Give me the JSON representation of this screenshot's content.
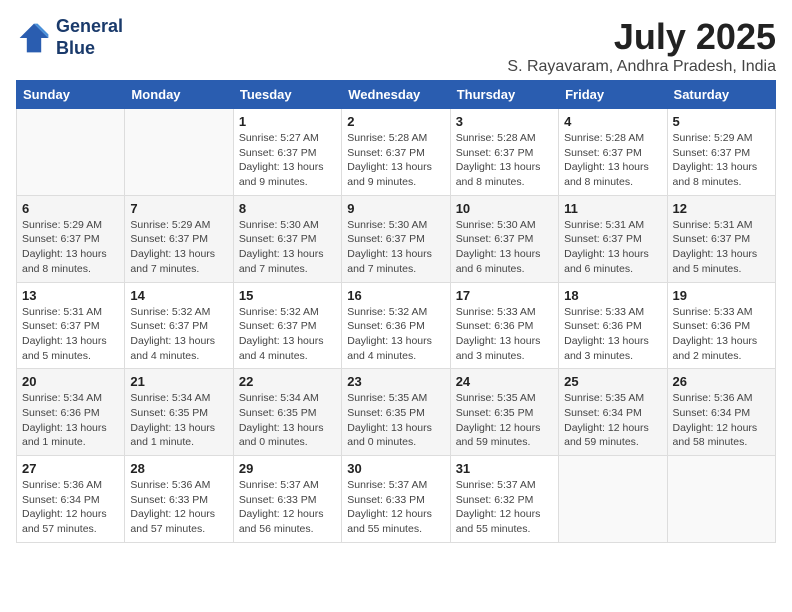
{
  "logo": {
    "line1": "General",
    "line2": "Blue"
  },
  "title": "July 2025",
  "subtitle": "S. Rayavaram, Andhra Pradesh, India",
  "weekdays": [
    "Sunday",
    "Monday",
    "Tuesday",
    "Wednesday",
    "Thursday",
    "Friday",
    "Saturday"
  ],
  "weeks": [
    [
      {
        "day": "",
        "info": ""
      },
      {
        "day": "",
        "info": ""
      },
      {
        "day": "1",
        "info": "Sunrise: 5:27 AM\nSunset: 6:37 PM\nDaylight: 13 hours\nand 9 minutes."
      },
      {
        "day": "2",
        "info": "Sunrise: 5:28 AM\nSunset: 6:37 PM\nDaylight: 13 hours\nand 9 minutes."
      },
      {
        "day": "3",
        "info": "Sunrise: 5:28 AM\nSunset: 6:37 PM\nDaylight: 13 hours\nand 8 minutes."
      },
      {
        "day": "4",
        "info": "Sunrise: 5:28 AM\nSunset: 6:37 PM\nDaylight: 13 hours\nand 8 minutes."
      },
      {
        "day": "5",
        "info": "Sunrise: 5:29 AM\nSunset: 6:37 PM\nDaylight: 13 hours\nand 8 minutes."
      }
    ],
    [
      {
        "day": "6",
        "info": "Sunrise: 5:29 AM\nSunset: 6:37 PM\nDaylight: 13 hours\nand 8 minutes."
      },
      {
        "day": "7",
        "info": "Sunrise: 5:29 AM\nSunset: 6:37 PM\nDaylight: 13 hours\nand 7 minutes."
      },
      {
        "day": "8",
        "info": "Sunrise: 5:30 AM\nSunset: 6:37 PM\nDaylight: 13 hours\nand 7 minutes."
      },
      {
        "day": "9",
        "info": "Sunrise: 5:30 AM\nSunset: 6:37 PM\nDaylight: 13 hours\nand 7 minutes."
      },
      {
        "day": "10",
        "info": "Sunrise: 5:30 AM\nSunset: 6:37 PM\nDaylight: 13 hours\nand 6 minutes."
      },
      {
        "day": "11",
        "info": "Sunrise: 5:31 AM\nSunset: 6:37 PM\nDaylight: 13 hours\nand 6 minutes."
      },
      {
        "day": "12",
        "info": "Sunrise: 5:31 AM\nSunset: 6:37 PM\nDaylight: 13 hours\nand 5 minutes."
      }
    ],
    [
      {
        "day": "13",
        "info": "Sunrise: 5:31 AM\nSunset: 6:37 PM\nDaylight: 13 hours\nand 5 minutes."
      },
      {
        "day": "14",
        "info": "Sunrise: 5:32 AM\nSunset: 6:37 PM\nDaylight: 13 hours\nand 4 minutes."
      },
      {
        "day": "15",
        "info": "Sunrise: 5:32 AM\nSunset: 6:37 PM\nDaylight: 13 hours\nand 4 minutes."
      },
      {
        "day": "16",
        "info": "Sunrise: 5:32 AM\nSunset: 6:36 PM\nDaylight: 13 hours\nand 4 minutes."
      },
      {
        "day": "17",
        "info": "Sunrise: 5:33 AM\nSunset: 6:36 PM\nDaylight: 13 hours\nand 3 minutes."
      },
      {
        "day": "18",
        "info": "Sunrise: 5:33 AM\nSunset: 6:36 PM\nDaylight: 13 hours\nand 3 minutes."
      },
      {
        "day": "19",
        "info": "Sunrise: 5:33 AM\nSunset: 6:36 PM\nDaylight: 13 hours\nand 2 minutes."
      }
    ],
    [
      {
        "day": "20",
        "info": "Sunrise: 5:34 AM\nSunset: 6:36 PM\nDaylight: 13 hours\nand 1 minute."
      },
      {
        "day": "21",
        "info": "Sunrise: 5:34 AM\nSunset: 6:35 PM\nDaylight: 13 hours\nand 1 minute."
      },
      {
        "day": "22",
        "info": "Sunrise: 5:34 AM\nSunset: 6:35 PM\nDaylight: 13 hours\nand 0 minutes."
      },
      {
        "day": "23",
        "info": "Sunrise: 5:35 AM\nSunset: 6:35 PM\nDaylight: 13 hours\nand 0 minutes."
      },
      {
        "day": "24",
        "info": "Sunrise: 5:35 AM\nSunset: 6:35 PM\nDaylight: 12 hours\nand 59 minutes."
      },
      {
        "day": "25",
        "info": "Sunrise: 5:35 AM\nSunset: 6:34 PM\nDaylight: 12 hours\nand 59 minutes."
      },
      {
        "day": "26",
        "info": "Sunrise: 5:36 AM\nSunset: 6:34 PM\nDaylight: 12 hours\nand 58 minutes."
      }
    ],
    [
      {
        "day": "27",
        "info": "Sunrise: 5:36 AM\nSunset: 6:34 PM\nDaylight: 12 hours\nand 57 minutes."
      },
      {
        "day": "28",
        "info": "Sunrise: 5:36 AM\nSunset: 6:33 PM\nDaylight: 12 hours\nand 57 minutes."
      },
      {
        "day": "29",
        "info": "Sunrise: 5:37 AM\nSunset: 6:33 PM\nDaylight: 12 hours\nand 56 minutes."
      },
      {
        "day": "30",
        "info": "Sunrise: 5:37 AM\nSunset: 6:33 PM\nDaylight: 12 hours\nand 55 minutes."
      },
      {
        "day": "31",
        "info": "Sunrise: 5:37 AM\nSunset: 6:32 PM\nDaylight: 12 hours\nand 55 minutes."
      },
      {
        "day": "",
        "info": ""
      },
      {
        "day": "",
        "info": ""
      }
    ]
  ]
}
